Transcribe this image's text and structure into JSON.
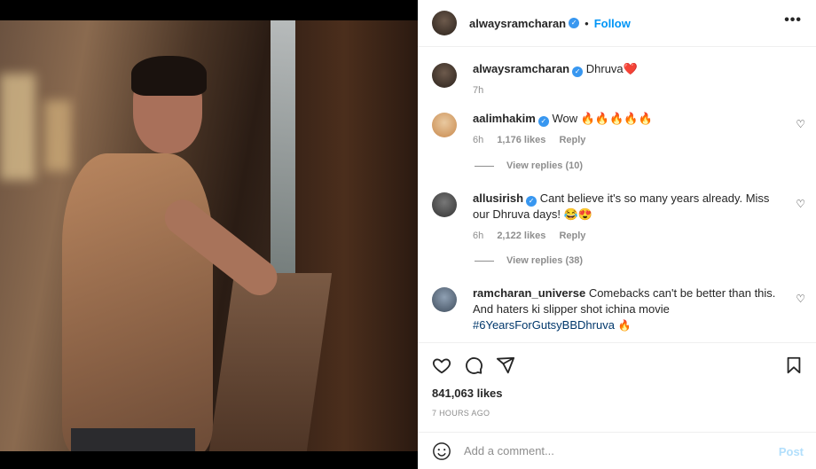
{
  "post": {
    "author": "alwaysramcharan",
    "follow_label": "Follow",
    "dot": "•",
    "more_label": "•••",
    "caption": "Dhruva❤️",
    "caption_time": "7h",
    "likes": "841,063 likes",
    "posted_ago": "7 HOURS AGO"
  },
  "comments": [
    {
      "user": "aalimhakim",
      "text": "Wow 🔥🔥🔥🔥🔥",
      "time": "6h",
      "likes": "1,176 likes",
      "reply": "Reply",
      "view_replies": "View replies (10)"
    },
    {
      "user": "allusirish",
      "text": "Cant believe it's so many years already. Miss our Dhruva days! 😂😍",
      "time": "6h",
      "likes": "2,122 likes",
      "reply": "Reply",
      "view_replies": "View replies (38)"
    },
    {
      "user": "ramcharan_universe",
      "text": "Comebacks can't be better than this. And haters ki slipper shot ichina movie",
      "hashtag": "#6YearsForGutsyBBDhruva",
      "emoji": "🔥"
    }
  ],
  "add_comment": {
    "placeholder": "Add a comment...",
    "post_label": "Post"
  },
  "colors": {
    "accent": "#0095f6",
    "verified": "#3897f0",
    "muted": "#8e8e8e"
  },
  "icons": [
    "heart-icon",
    "comment-icon",
    "share-icon",
    "bookmark-icon",
    "emoji-icon",
    "more-icon",
    "verified-icon"
  ]
}
